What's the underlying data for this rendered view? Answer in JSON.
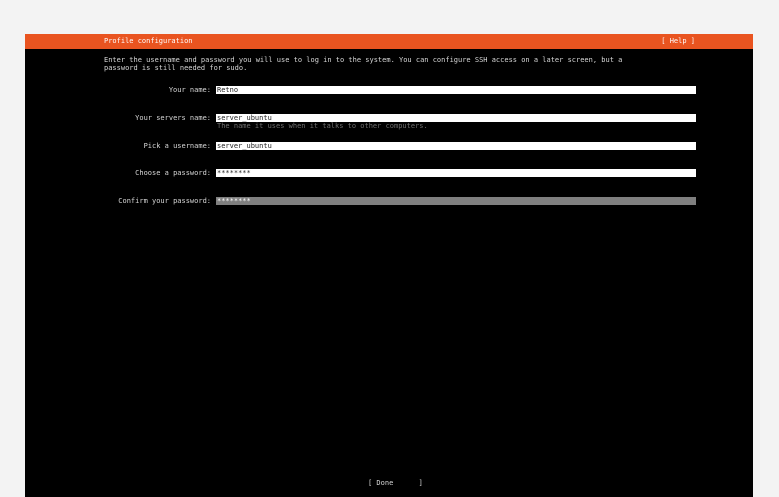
{
  "header": {
    "title": "Profile configuration",
    "help_label": "[ Help ]"
  },
  "intro_text": "Enter the username and password you will use to log in to the system. You can configure SSH access on a later screen, but a\npassword is still needed for sudo.",
  "form": {
    "your_name": {
      "label": "Your name:",
      "value": "Retno"
    },
    "server_name": {
      "label": "Your servers name:",
      "value": "server_ubuntu",
      "hint": "The name it uses when it talks to other computers."
    },
    "username": {
      "label": "Pick a username:",
      "value": "server_ubuntu"
    },
    "password": {
      "label": "Choose a password:",
      "value": "********"
    },
    "confirm_password": {
      "label": "Confirm your password:",
      "value": "********"
    }
  },
  "footer": {
    "done_label": "[ Done      ]"
  },
  "colors": {
    "header_bg": "#e95420",
    "terminal_bg": "#000000",
    "focused_field_bg": "#7f7f7f"
  }
}
